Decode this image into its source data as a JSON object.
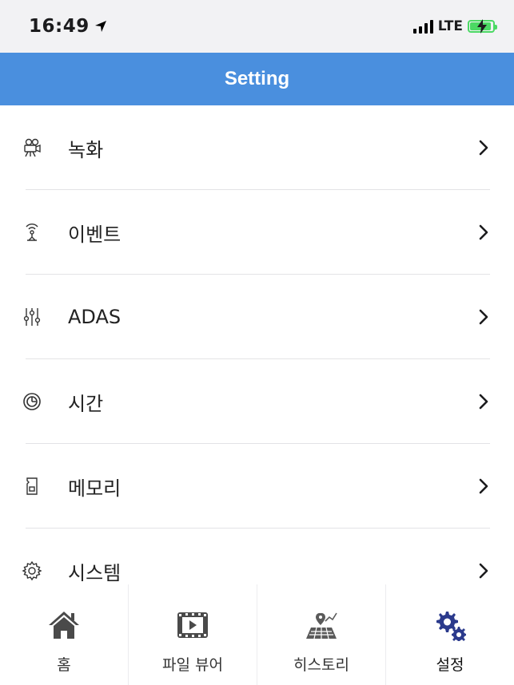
{
  "status_bar": {
    "time": "16:49",
    "network": "LTE",
    "icons": [
      "location-arrow-icon",
      "signal-bars-icon",
      "battery-charging-icon"
    ],
    "battery_color": "#4cd964"
  },
  "header": {
    "title": "Setting",
    "background": "#4a8fde"
  },
  "menu": {
    "items": [
      {
        "label": "녹화",
        "icon": "camcorder-icon"
      },
      {
        "label": "이벤트",
        "icon": "antenna-icon"
      },
      {
        "label": "ADAS",
        "icon": "sliders-icon"
      },
      {
        "label": "시간",
        "icon": "clock-icon"
      },
      {
        "label": "메모리",
        "icon": "sd-card-icon"
      },
      {
        "label": "시스템",
        "icon": "gear-icon"
      }
    ]
  },
  "tabbar": {
    "tabs": [
      {
        "label": "홈",
        "icon": "home-icon"
      },
      {
        "label": "파일 뷰어",
        "icon": "video-file-icon"
      },
      {
        "label": "히스토리",
        "icon": "map-pin-icon"
      },
      {
        "label": "설정",
        "icon": "gears-icon",
        "active": true
      }
    ],
    "active_color": "#2b3a8c"
  }
}
